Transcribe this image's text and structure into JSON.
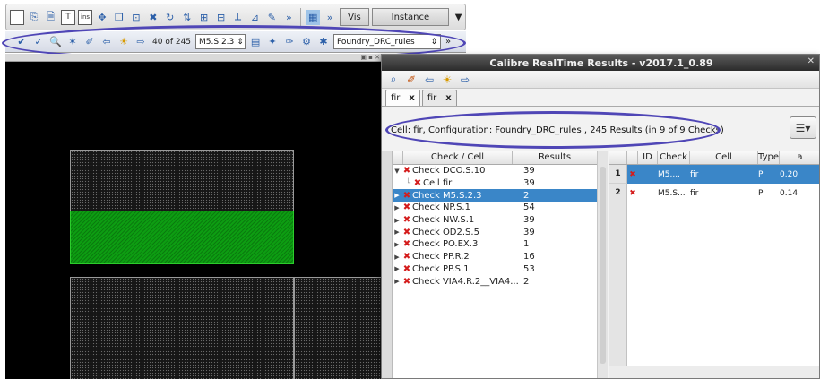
{
  "editor": {
    "toolbar1": {
      "box_icon_text": "T",
      "ins_label": "ins",
      "vis_label": "Vis",
      "instance_label": "Instance"
    },
    "toolbar2": {
      "counter": "40 of 245",
      "check_combo": "M5.S.2.3",
      "rules_combo": "Foundry_DRC_rules"
    }
  },
  "results_window": {
    "title": "Calibre RealTime Results - v2017.1_0.89",
    "tabs": [
      {
        "label": "fir"
      },
      {
        "label": "fir"
      }
    ],
    "info_text": "Cell: fir, Configuration: Foundry_DRC_rules , 245 Results (in 9 of 9 Checks)",
    "tree": {
      "header_check": "Check / Cell",
      "header_results": "Results",
      "rows": [
        {
          "name": "Check DCO.S.10",
          "value": "39"
        },
        {
          "name": "Cell fir",
          "value": "39"
        },
        {
          "name": "Check M5.S.2.3",
          "value": "2"
        },
        {
          "name": "Check NP.S.1",
          "value": "54"
        },
        {
          "name": "Check NW.S.1",
          "value": "39"
        },
        {
          "name": "Check OD2.S.5",
          "value": "39"
        },
        {
          "name": "Check PO.EX.3",
          "value": "1"
        },
        {
          "name": "Check PP.R.2",
          "value": "16"
        },
        {
          "name": "Check PP.S.1",
          "value": "53"
        },
        {
          "name": "Check VIA4.R.2__VIA4...",
          "value": "2"
        }
      ]
    },
    "results": {
      "headers": {
        "id": "ID",
        "check": "Check",
        "cell": "Cell",
        "type": "Type",
        "val": "a"
      },
      "rows": [
        {
          "num": "1",
          "check": "M5....",
          "cell": "fir",
          "type": "P",
          "val": "0.20"
        },
        {
          "num": "2",
          "check": "M5.S...",
          "cell": "fir",
          "type": "P",
          "val": "0.14"
        }
      ]
    }
  }
}
